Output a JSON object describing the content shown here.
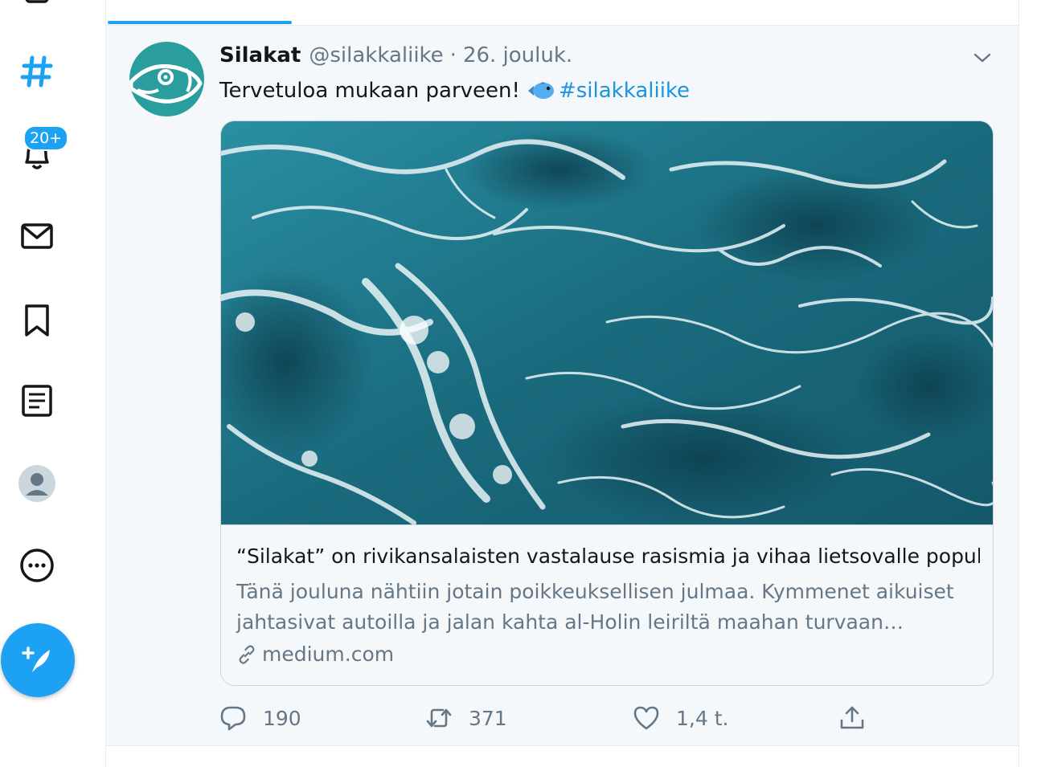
{
  "sidebar": {
    "notifications_badge": "20+"
  },
  "tweet": {
    "author_name": "Silakat",
    "author_handle": "@silakkaliike",
    "separator": "·",
    "timestamp": "26. jouluk.",
    "text_before": "Tervetuloa mukaan parveen!",
    "emoji": "fish-emoji",
    "hashtag": "#silakkaliike",
    "card": {
      "title": "“Silakat” on rivikansalaisten vastalause rasismia ja vihaa lietsovalle popul…",
      "description": "Tänä jouluna nähtiin jotain poikkeuksellisen julmaa. Kymmenet aikuiset jahtasivat autoilla ja jalan kahta al-Holin leiriltä maahan turvaan…",
      "domain": "medium.com"
    },
    "actions": {
      "reply_count": "190",
      "retweet_count": "371",
      "like_count": "1,4 t."
    }
  },
  "colors": {
    "accent": "#1da1f2",
    "text": "#14171a",
    "muted": "#657786",
    "tweet_bg": "#f5f8fa",
    "avatar_bg": "#2a9d9f"
  }
}
